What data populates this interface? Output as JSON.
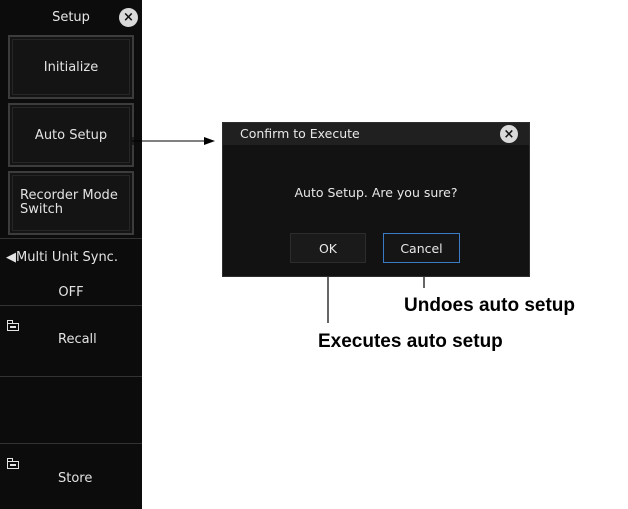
{
  "panel": {
    "title": "Setup",
    "close_glyph": "×",
    "initialize_label": "Initialize",
    "auto_setup_label": "Auto Setup",
    "recorder_mode_line1": "Recorder Mode",
    "recorder_mode_line2": "Switch",
    "multi_unit_label": "◀Multi Unit Sync.",
    "multi_unit_value": "OFF",
    "recall_label": "Recall",
    "store_label": "Store",
    "recall_icon": "folder-icon",
    "store_icon": "folder-icon"
  },
  "dialog": {
    "title": "Confirm to Execute",
    "close_glyph": "×",
    "message": "Auto Setup. Are you sure?",
    "ok_label": "OK",
    "cancel_label": "Cancel",
    "focus_color": "#3a7bc8"
  },
  "annotations": {
    "undoes": "Undoes auto setup",
    "executes": "Executes auto setup"
  }
}
